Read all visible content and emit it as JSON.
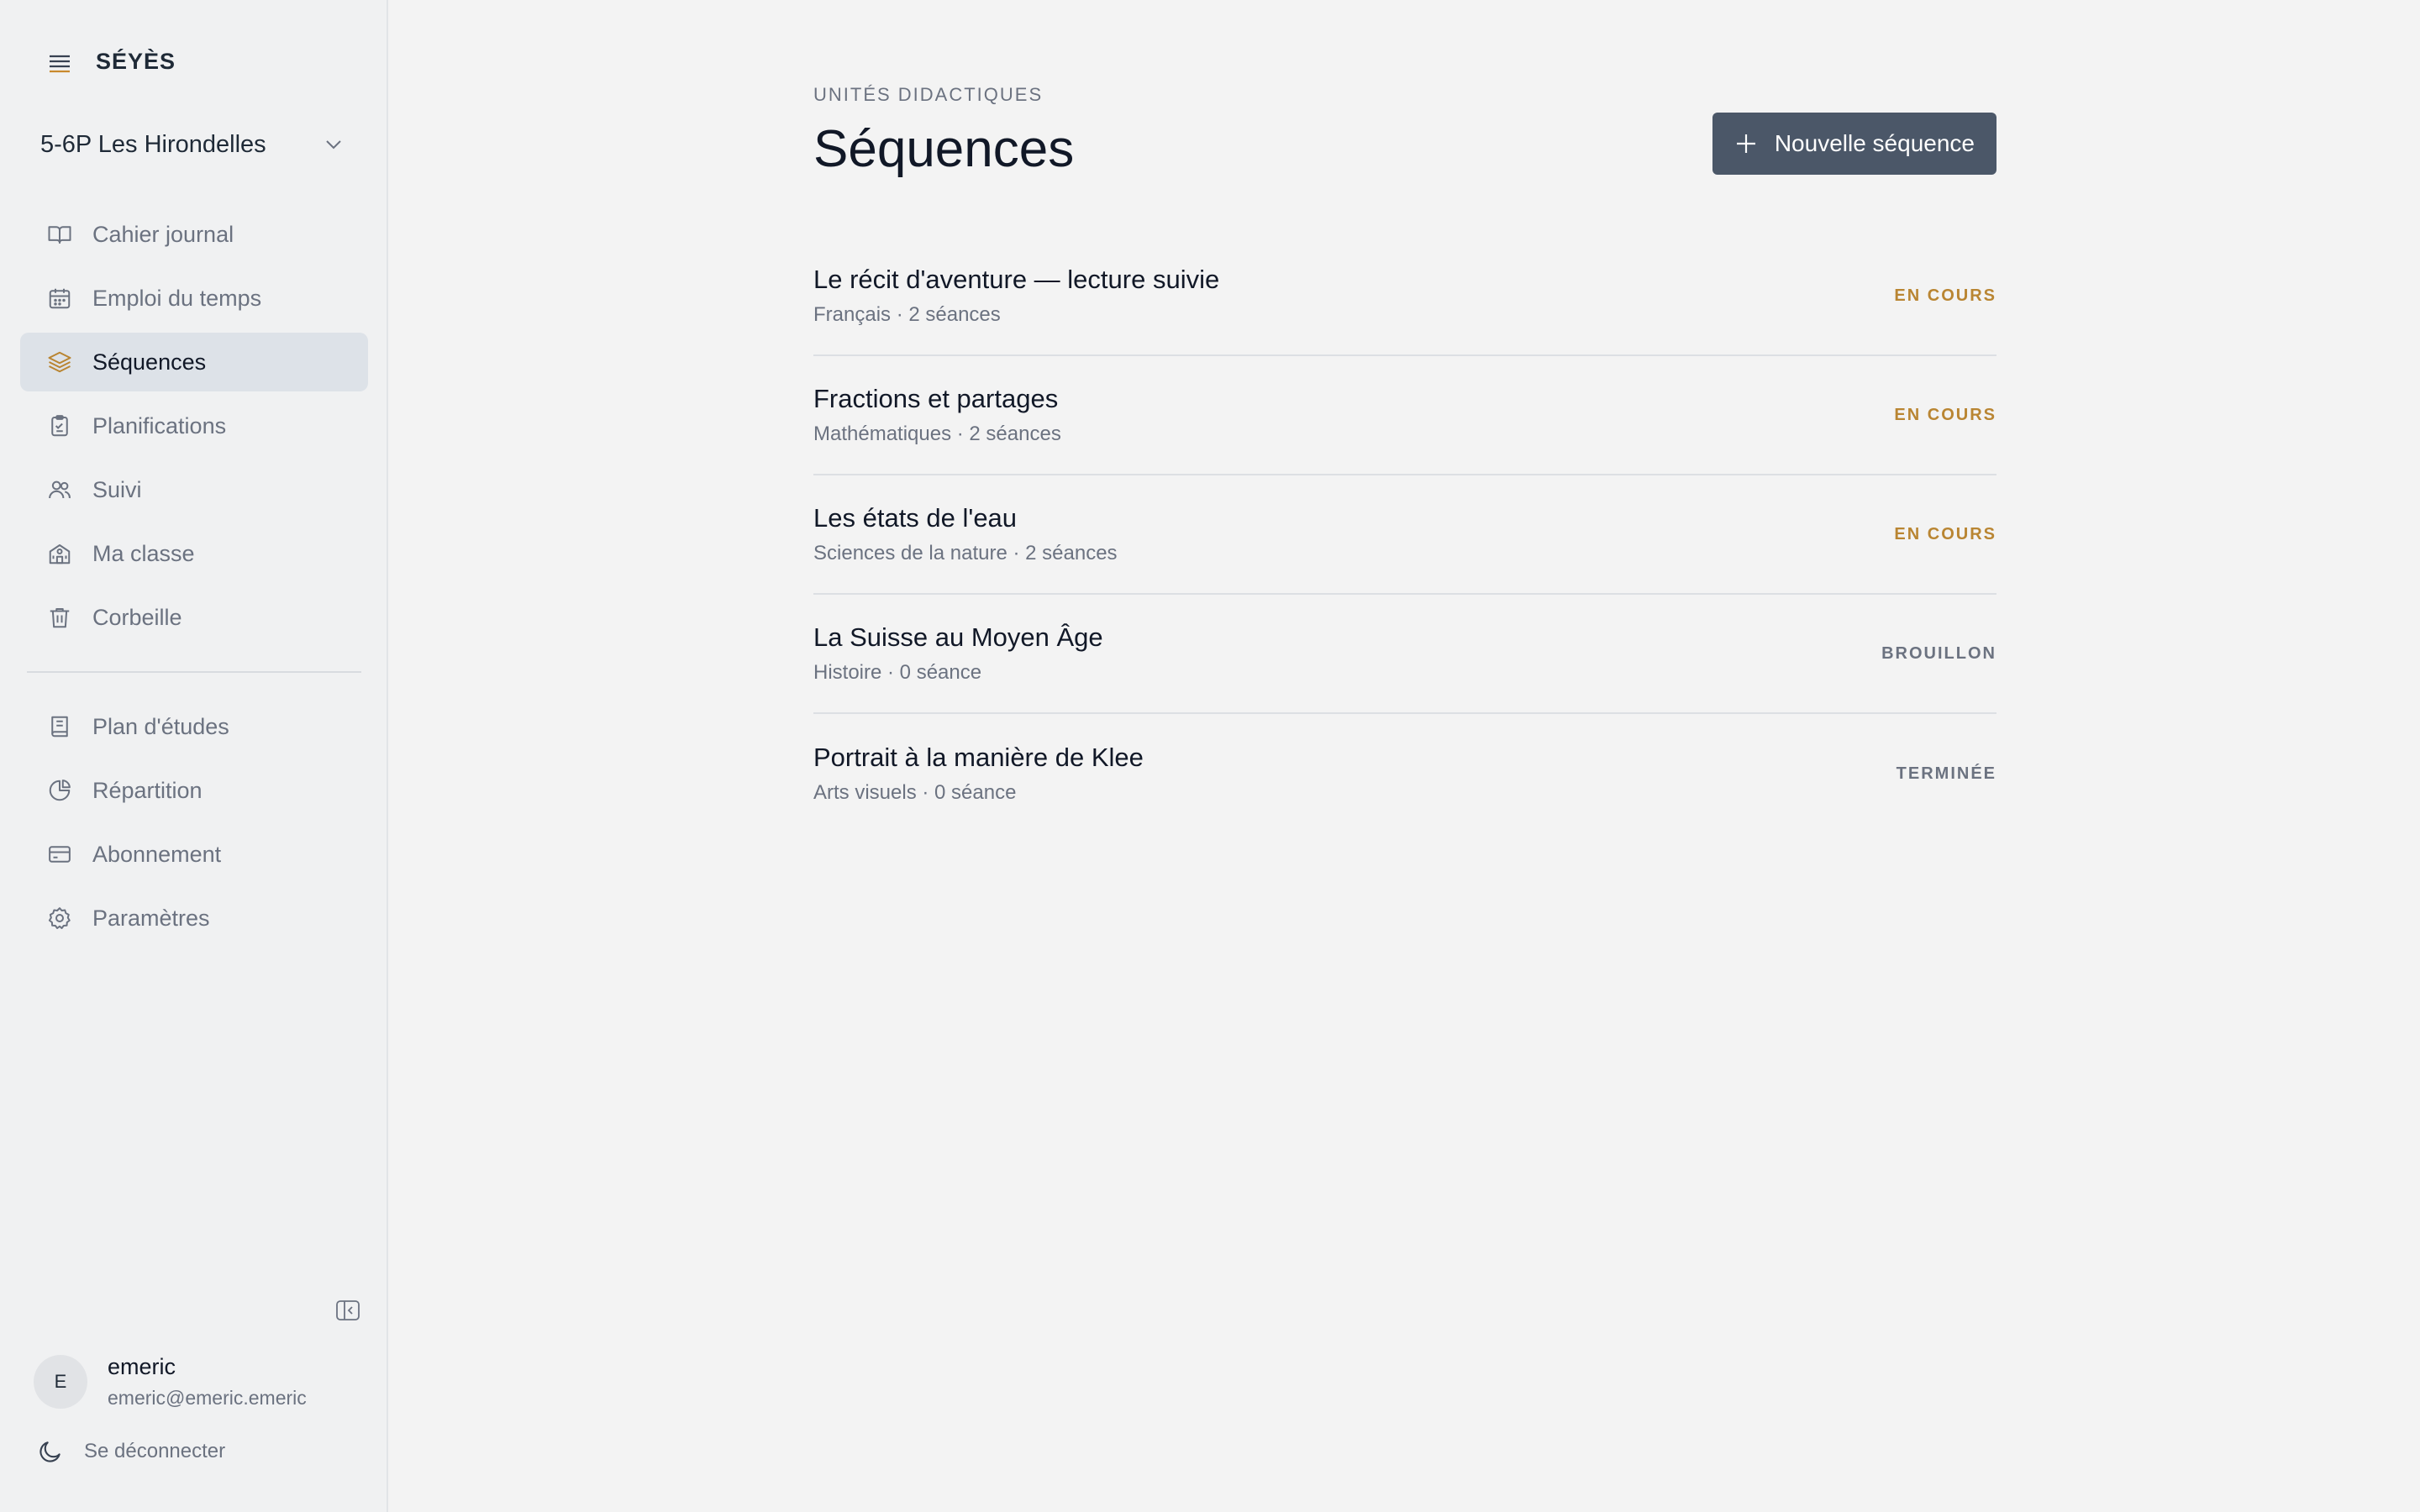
{
  "app": {
    "brand": "SÉYÈS"
  },
  "class_selector": {
    "selected": "5-6P Les Hirondelles"
  },
  "nav_primary": [
    {
      "label": "Cahier journal",
      "icon": "book-open-icon",
      "active": false
    },
    {
      "label": "Emploi du temps",
      "icon": "calendar-icon",
      "active": false
    },
    {
      "label": "Séquences",
      "icon": "layers-icon",
      "active": true
    },
    {
      "label": "Planifications",
      "icon": "clipboard-icon",
      "active": false
    },
    {
      "label": "Suivi",
      "icon": "users-icon",
      "active": false
    },
    {
      "label": "Ma classe",
      "icon": "school-icon",
      "active": false
    },
    {
      "label": "Corbeille",
      "icon": "trash-icon",
      "active": false
    }
  ],
  "nav_secondary": [
    {
      "label": "Plan d'études",
      "icon": "book-icon"
    },
    {
      "label": "Répartition",
      "icon": "pie-chart-icon"
    },
    {
      "label": "Abonnement",
      "icon": "credit-card-icon"
    },
    {
      "label": "Paramètres",
      "icon": "gear-icon"
    }
  ],
  "user": {
    "initial": "E",
    "name": "emeric",
    "email": "emeric@emeric.emeric",
    "logout_label": "Se déconnecter"
  },
  "page": {
    "eyebrow": "UNITÉS DIDACTIQUES",
    "title": "Séquences",
    "new_button_label": "Nouvelle séquence"
  },
  "sequences": [
    {
      "title": "Le récit d'aventure — lecture suivie",
      "meta": "Français · 2 séances",
      "status": "EN COURS",
      "status_kind": "en_cours"
    },
    {
      "title": "Fractions et partages",
      "meta": "Mathématiques · 2 séances",
      "status": "EN COURS",
      "status_kind": "en_cours"
    },
    {
      "title": "Les états de l'eau",
      "meta": "Sciences de la nature · 2 séances",
      "status": "EN COURS",
      "status_kind": "en_cours"
    },
    {
      "title": "La Suisse au Moyen Âge",
      "meta": "Histoire · 0 séance",
      "status": "BROUILLON",
      "status_kind": "brouillon"
    },
    {
      "title": "Portrait à la manière de Klee",
      "meta": "Arts visuels · 0 séance",
      "status": "TERMINÉE",
      "status_kind": "terminee"
    }
  ],
  "colors": {
    "accent": "#b98532",
    "button_bg": "#4b5768",
    "active_nav_bg": "#dde2e8"
  }
}
